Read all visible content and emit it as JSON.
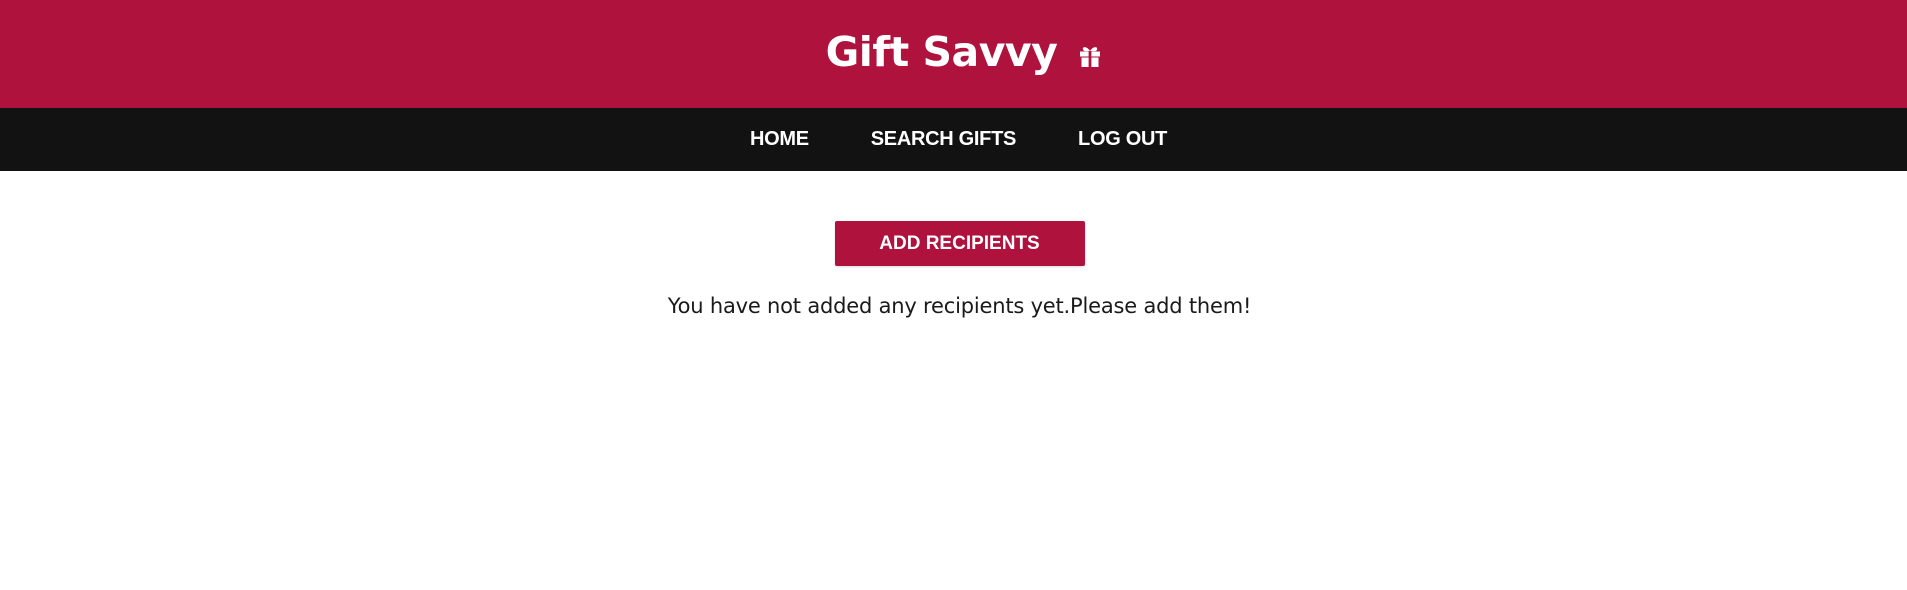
{
  "header": {
    "title": "Gift Savvy",
    "icon": "gift-icon",
    "background_color": "#ae123d"
  },
  "nav": {
    "background_color": "#121212",
    "items": [
      {
        "label": "HOME"
      },
      {
        "label": "SEARCH GIFTS"
      },
      {
        "label": "LOG OUT"
      }
    ]
  },
  "main": {
    "add_button_label": "ADD RECIPIENTS",
    "empty_message": "You have not added any recipients yet.Please add them!"
  }
}
